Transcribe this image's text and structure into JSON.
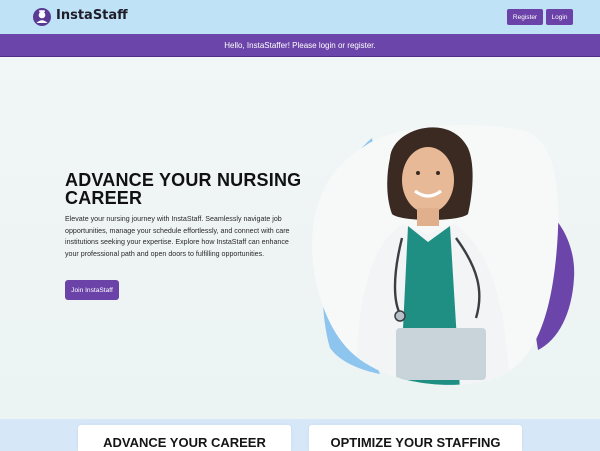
{
  "header": {
    "brand": "InstaStaff",
    "register_label": "Register",
    "login_label": "Login"
  },
  "banner": {
    "message": "Hello, InstaStaffer! Please login or register."
  },
  "hero": {
    "title": "ADVANCE YOUR NURSING CAREER",
    "description": "Elevate your nursing journey with InstaStaff. Seamlessly navigate job opportunities, manage your schedule effortlessly, and connect with care institutions seeking your expertise. Explore how InstaStaff can enhance your professional path and open doors to fulfilling opportunities.",
    "cta_label": "Join InstaStaff"
  },
  "features": {
    "cards": [
      {
        "title": "ADVANCE YOUR CAREER"
      },
      {
        "title": "OPTIMIZE YOUR STAFFING"
      }
    ]
  },
  "colors": {
    "topbar": "#bfe2f7",
    "accent_purple": "#6b45a9",
    "shape_blue": "#8ec5ee"
  }
}
